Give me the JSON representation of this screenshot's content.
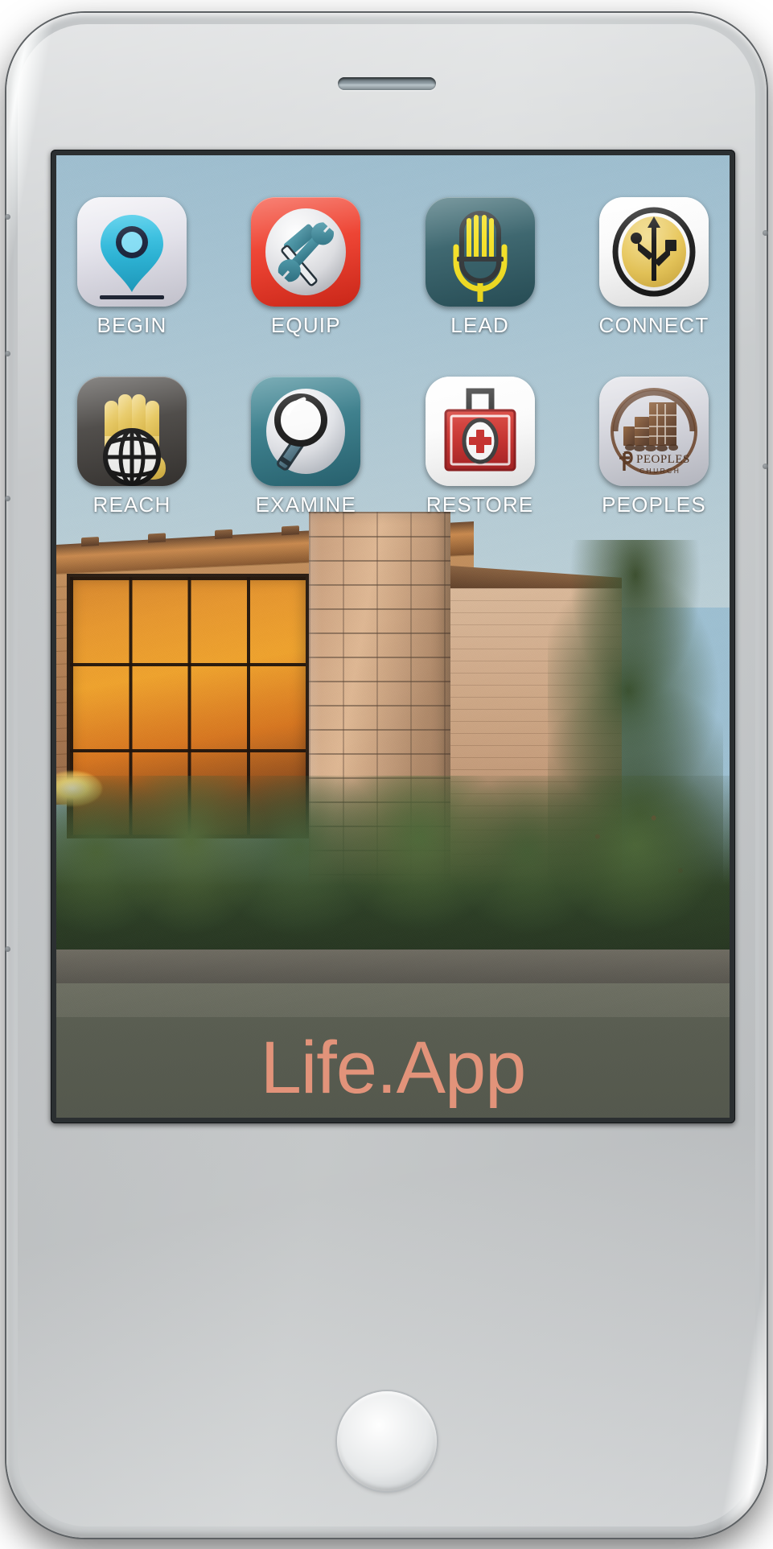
{
  "device": {
    "type": "smartphone-mockup",
    "body_color": "#cfd2d3",
    "earpiece_name": "earpiece-speaker",
    "home_button_name": "home-button"
  },
  "screen": {
    "wallpaper_description": "church-building-at-sunset",
    "sky_color": "#a9c5d3",
    "sunset_color": "#e8982f"
  },
  "home_screen": {
    "rows": [
      {
        "apps": [
          {
            "label": "BEGIN",
            "icon": "map-pin-icon",
            "bg": "#e4e3ec",
            "accent": "#29b4d6"
          },
          {
            "label": "EQUIP",
            "icon": "hammer-wrench-icon",
            "bg": "#ea3524",
            "accent": "#2f7c8c"
          },
          {
            "label": "LEAD",
            "icon": "microphone-icon",
            "bg": "#2f5a63",
            "accent": "#f5e01e"
          },
          {
            "label": "CONNECT",
            "icon": "usb-connect-icon",
            "bg": "#ffffff",
            "accent": "#e8c552"
          }
        ]
      },
      {
        "apps": [
          {
            "label": "REACH",
            "icon": "hand-globe-icon",
            "bg": "#403d3a",
            "accent": "#e8c85b"
          },
          {
            "label": "EXAMINE",
            "icon": "magnifying-glass-icon",
            "bg": "#2f7482",
            "accent": "#46707f"
          },
          {
            "label": "RESTORE",
            "icon": "first-aid-kit-icon",
            "bg": "#ffffff",
            "accent": "#c62b28"
          },
          {
            "label": "PEOPLES",
            "icon": "peoples-church-logo",
            "bg": "#cfd0d8",
            "accent": "#6b4328"
          }
        ]
      }
    ]
  },
  "brand": {
    "text": "Life.App",
    "text_color": "#e2937a",
    "band_color": "#585c50"
  },
  "logo": {
    "peoples_line1": "PEOPLES",
    "peoples_line2": "CHURCH"
  }
}
